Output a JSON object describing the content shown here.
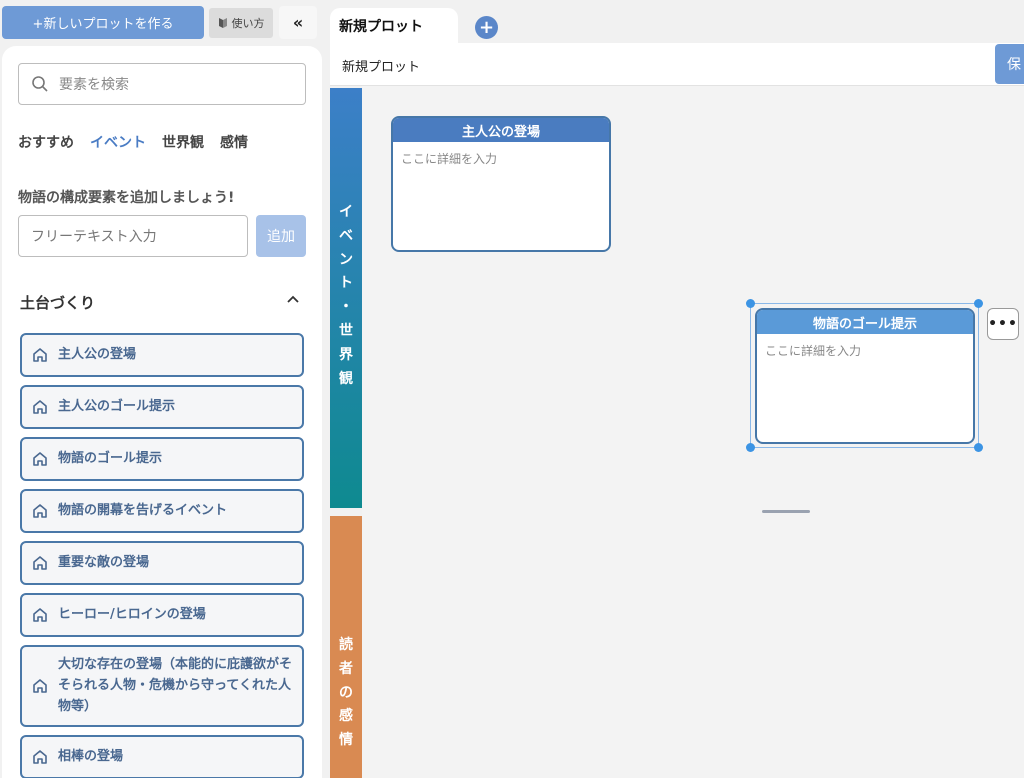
{
  "sidebar_top": {
    "new_plot_label": "+新しいプロットを作る",
    "usage_label": "使い方",
    "collapse_icon": "«"
  },
  "search": {
    "placeholder": "要素を検索"
  },
  "category_tabs": [
    {
      "label": "おすすめ"
    },
    {
      "label": "イベント"
    },
    {
      "label": "世界観"
    },
    {
      "label": "感情"
    }
  ],
  "add_section": {
    "heading": "物語の構成要素を追加しましょう!",
    "input_placeholder": "フリーテキスト入力",
    "add_label": "追加"
  },
  "group": {
    "title": "土台づくり",
    "items": [
      {
        "label": "主人公の登場"
      },
      {
        "label": "主人公のゴール提示"
      },
      {
        "label": "物語のゴール提示"
      },
      {
        "label": "物語の開幕を告げるイベント"
      },
      {
        "label": "重要な敵の登場"
      },
      {
        "label": "ヒーロー/ヒロインの登場"
      },
      {
        "label": "大切な存在の登場（本能的に庇護欲がそそられる人物・危機から守ってくれた人物等）"
      },
      {
        "label": "相棒の登場"
      }
    ]
  },
  "tabs": {
    "active_label": "新規プロット",
    "add_icon": "+"
  },
  "plot": {
    "title": "新規プロット",
    "save_label": "保"
  },
  "lanes": {
    "event_world": [
      "イ",
      "ベ",
      "ン",
      "ト",
      "・",
      "世",
      "界",
      "観"
    ],
    "reader_emotion": [
      "読",
      "者",
      "の",
      "感",
      "情"
    ]
  },
  "cards": [
    {
      "title": "主人公の登場",
      "placeholder": "ここに詳細を入力"
    },
    {
      "title": "物語のゴール提示",
      "placeholder": "ここに詳細を入力"
    }
  ],
  "more_icon": "•••",
  "colors": {
    "primary": "#6e9ad6",
    "item_border": "#4a78a8",
    "event_lane_top": "#3c7fc8",
    "event_lane_bottom": "#0e8a90",
    "emotion_lane": "#d98a52"
  }
}
